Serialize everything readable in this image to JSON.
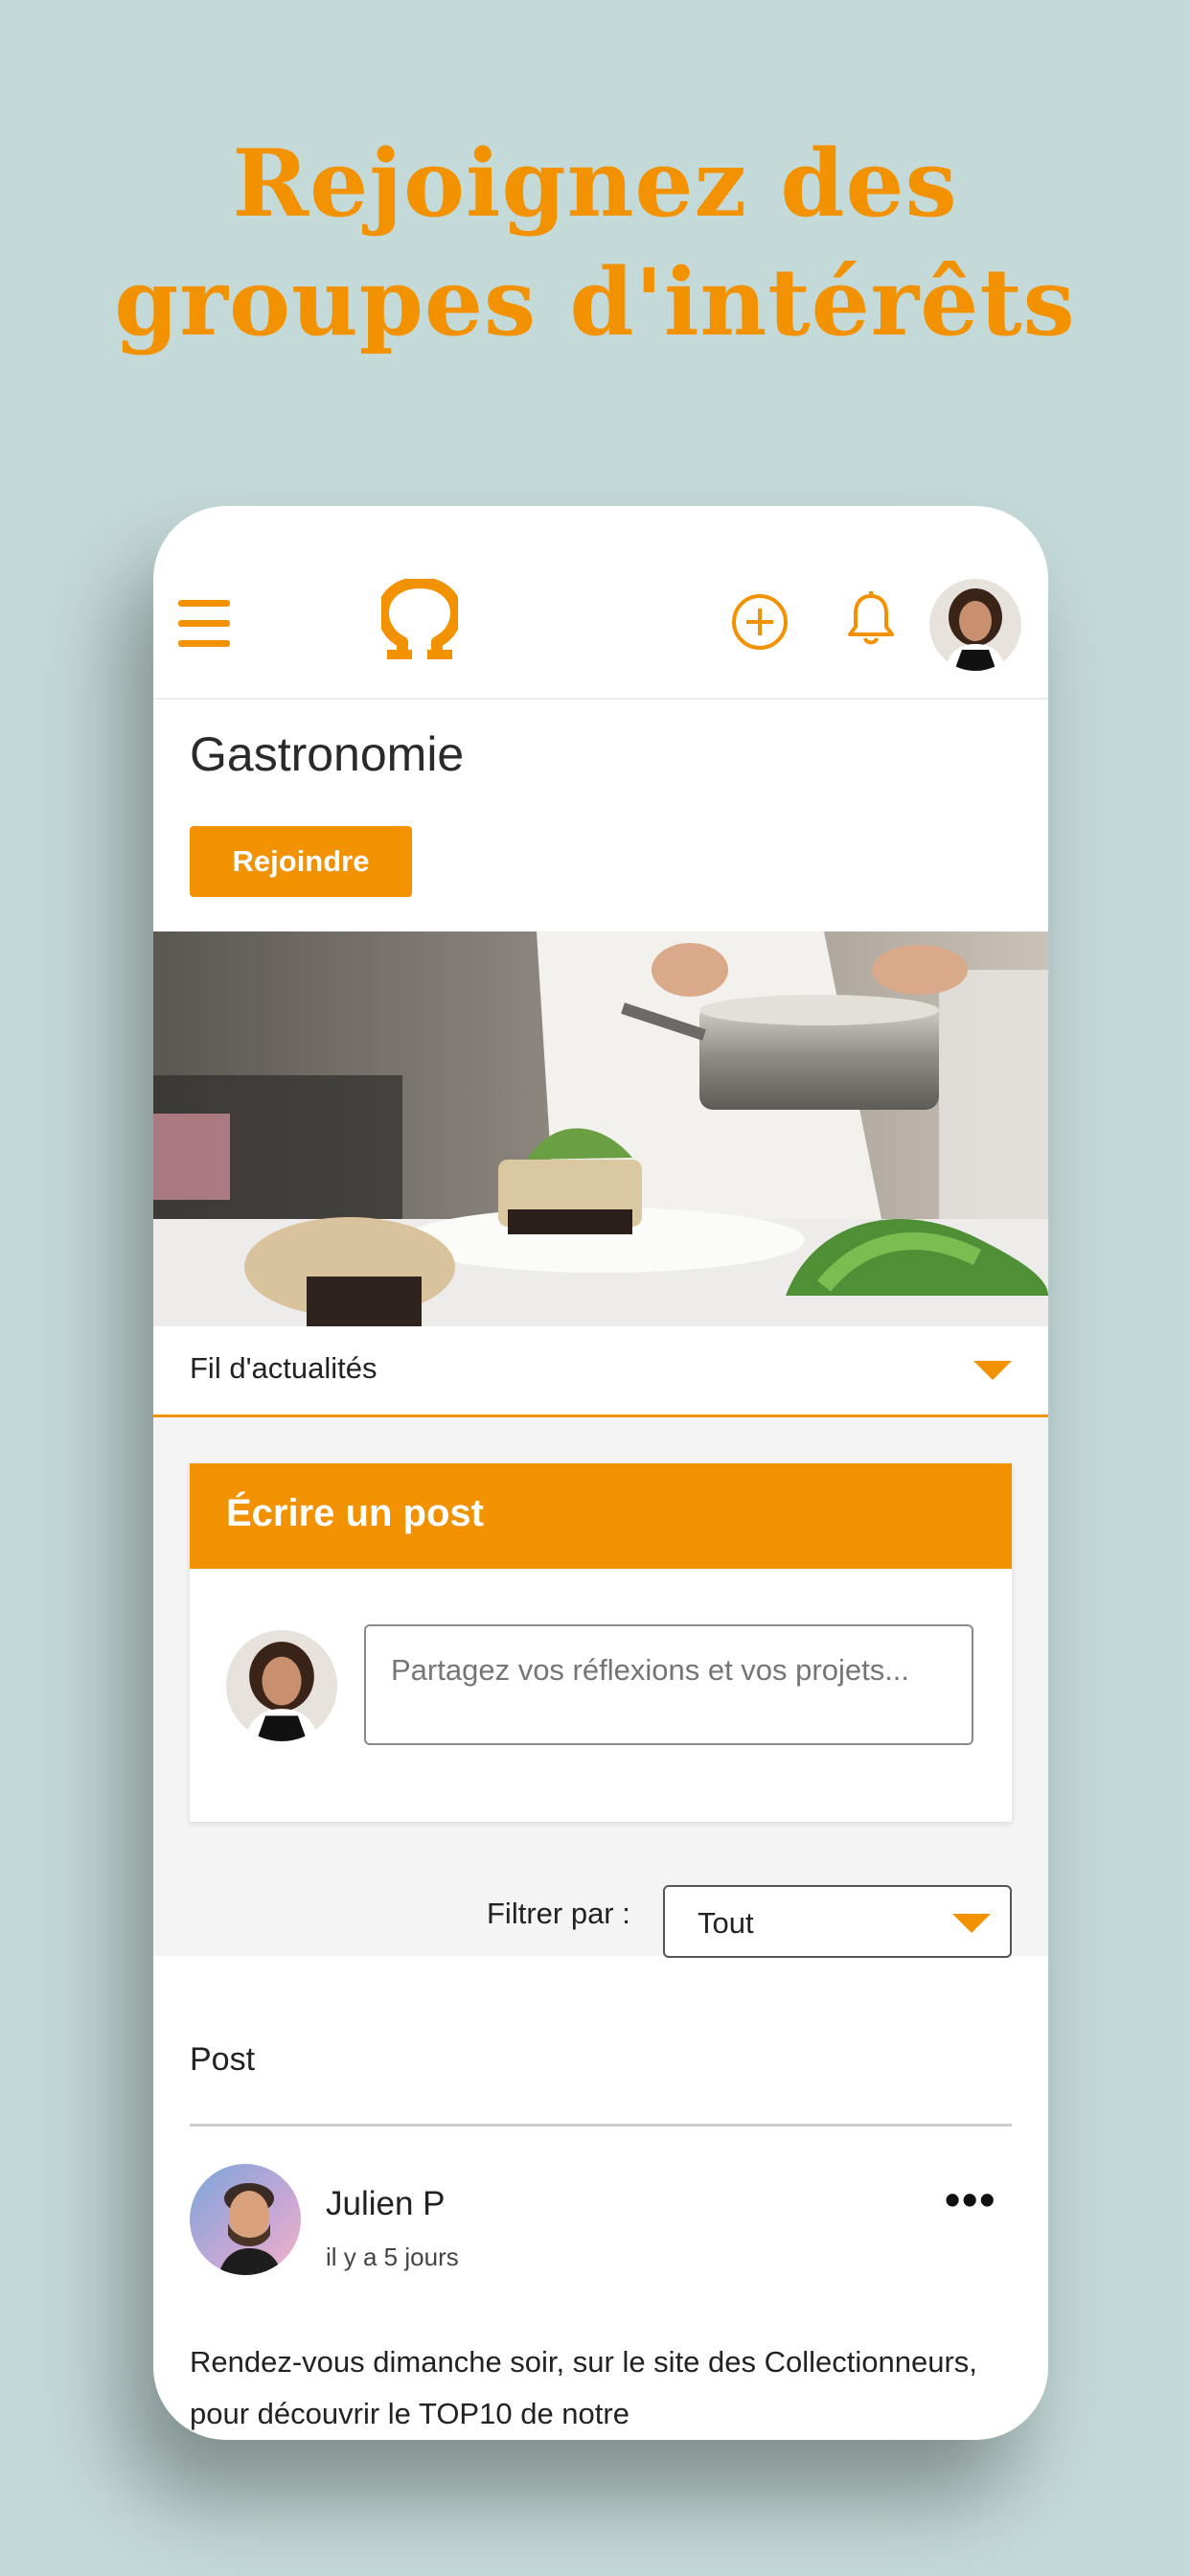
{
  "promo": {
    "headline_line1": "Rejoignez des",
    "headline_line2": "groupes d'intérêts"
  },
  "topbar": {
    "menu_icon": "hamburger-menu-icon",
    "logo_icon": "omega-logo-icon",
    "add_icon": "plus-circle-icon",
    "notifications_icon": "bell-icon",
    "avatar_icon": "user-avatar"
  },
  "group": {
    "title": "Gastronomie",
    "join_label": "Rejoindre"
  },
  "feed": {
    "selector_label": "Fil d'actualités"
  },
  "compose": {
    "title": "Écrire un post",
    "placeholder": "Partagez vos réflexions et vos projets..."
  },
  "filter": {
    "label": "Filtrer par :",
    "value": "Tout"
  },
  "posts": {
    "section_label": "Post",
    "items": [
      {
        "author": "Julien P",
        "time": "il y a 5 jours",
        "text": "Rendez-vous dimanche soir, sur le site des Collectionneurs, pour découvrir le TOP10 de notre"
      }
    ]
  },
  "colors": {
    "accent": "#f39200",
    "background": "#c4dad9",
    "card_bg": "#f4f4f4"
  }
}
